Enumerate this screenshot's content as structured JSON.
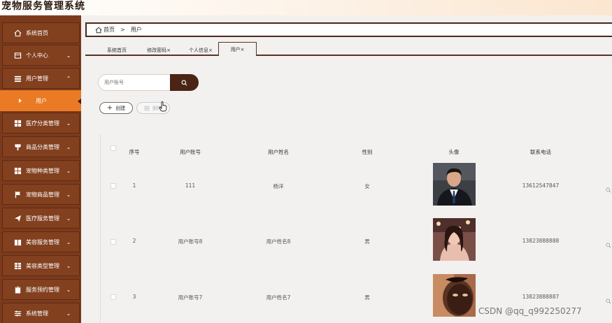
{
  "app": {
    "title": "宠物服务管理系统"
  },
  "sidebar": {
    "items": [
      {
        "label": "系统首页",
        "icon": "home-icon"
      },
      {
        "label": "个人中心",
        "icon": "profile-icon"
      },
      {
        "label": "用户管理",
        "icon": "list-icon"
      },
      {
        "label": "用户",
        "icon": "caret-right-icon",
        "active": true
      },
      {
        "label": "医疗分类管理",
        "icon": "grid-icon"
      },
      {
        "label": "商品分类管理",
        "icon": "cup-icon"
      },
      {
        "label": "宠物种类管理",
        "icon": "grid-icon"
      },
      {
        "label": "宠物商品管理",
        "icon": "flag-icon"
      },
      {
        "label": "医疗服务管理",
        "icon": "send-icon"
      },
      {
        "label": "美容服务管理",
        "icon": "book-icon"
      },
      {
        "label": "美容类型管理",
        "icon": "table-icon"
      },
      {
        "label": "服务预约管理",
        "icon": "clipboard-icon"
      },
      {
        "label": "系统管理",
        "icon": "sliders-icon"
      }
    ]
  },
  "breadcrumb": {
    "home": "首页",
    "separator": ">",
    "current": "用户"
  },
  "tabs": [
    {
      "label": "系统首页"
    },
    {
      "label": "修改密码",
      "close": "×"
    },
    {
      "label": "个人信息",
      "close": "×"
    },
    {
      "label": "用户",
      "close": "×",
      "active": true
    }
  ],
  "search": {
    "placeholder": "用户账号"
  },
  "actions": {
    "create": "创建",
    "delete": "删除"
  },
  "table": {
    "columns": [
      "序号",
      "用户账号",
      "用户姓名",
      "性别",
      "头像",
      "联系电话"
    ],
    "rows": [
      {
        "index": "1",
        "account": "111",
        "name": "杨洋",
        "gender": "女",
        "phone": "13612547847",
        "avatar": "man-in-suit-photo"
      },
      {
        "index": "2",
        "account": "用户账号8",
        "name": "用户姓名8",
        "gender": "男",
        "phone": "13823888888",
        "avatar": "woman-portrait-photo"
      },
      {
        "index": "3",
        "account": "用户账号7",
        "name": "用户姓名7",
        "gender": "男",
        "phone": "13823888887",
        "avatar": "man-closeup-photo"
      }
    ]
  },
  "watermark": "CSDN @qq_q992250277",
  "colors": {
    "sidebar": "#7c3a1d",
    "active": "#ea7a23",
    "accent_dark": "#4a2414"
  }
}
